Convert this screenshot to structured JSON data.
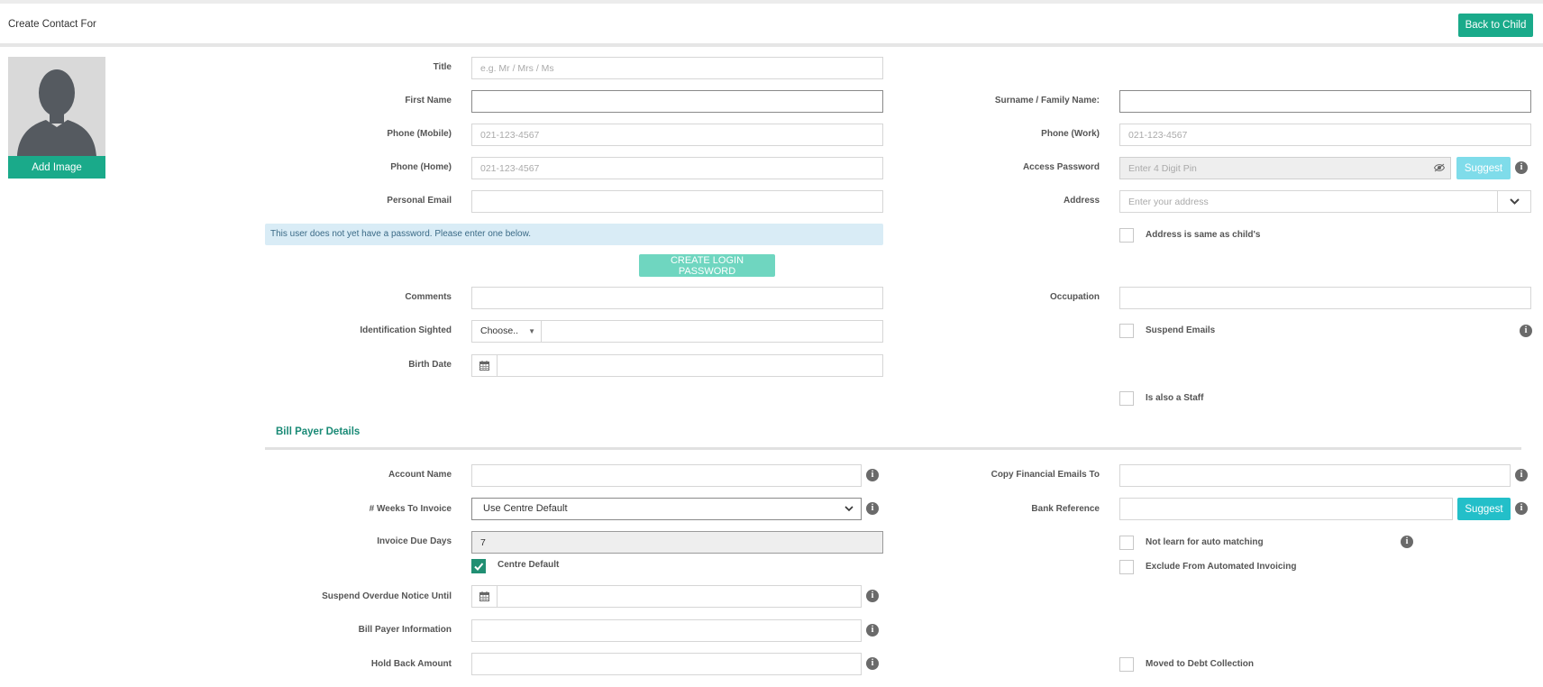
{
  "header": {
    "title": "Create Contact For",
    "back_button": "Back to Child"
  },
  "profile": {
    "add_image_button": "Add Image"
  },
  "form": {
    "title_label": "Title",
    "title_placeholder": "e.g. Mr / Mrs / Ms",
    "first_name_label": "First Name",
    "surname_label": "Surname / Family Name:",
    "phone_mobile_label": "Phone (Mobile)",
    "phone_mobile_placeholder": "021-123-4567",
    "phone_work_label": "Phone (Work)",
    "phone_work_placeholder": "021-123-4567",
    "phone_home_label": "Phone (Home)",
    "phone_home_placeholder": "021-123-4567",
    "access_password_label": "Access Password",
    "access_password_placeholder": "Enter 4 Digit Pin",
    "suggest_label": "Suggest",
    "personal_email_label": "Personal Email",
    "address_label": "Address",
    "address_placeholder": "Enter your address",
    "password_notice": "This user does not yet have a password. Please enter one below.",
    "address_same_label": "Address is same as child's",
    "create_login_password": "CREATE LOGIN PASSWORD",
    "comments_label": "Comments",
    "occupation_label": "Occupation",
    "identification_label": "Identification Sighted",
    "identification_choose": "Choose..",
    "suspend_emails_label": "Suspend Emails",
    "birth_date_label": "Birth Date",
    "is_staff_label": "Is also a Staff"
  },
  "bill_payer": {
    "section_title": "Bill Payer Details",
    "account_name_label": "Account Name",
    "copy_financial_label": "Copy Financial Emails To",
    "weeks_label": "# Weeks To Invoice",
    "weeks_value": "Use Centre Default",
    "bank_reference_label": "Bank Reference",
    "suggest_label": "Suggest",
    "invoice_due_label": "Invoice Due Days",
    "invoice_due_value": "7",
    "not_learn_label": "Not learn for auto matching",
    "exclude_label": "Exclude From Automated Invoicing",
    "centre_default_label": "Centre Default",
    "suspend_overdue_label": "Suspend Overdue Notice Until",
    "bill_payer_info_label": "Bill Payer Information",
    "hold_back_label": "Hold Back Amount",
    "debt_collection_label": "Moved to Debt Collection"
  },
  "colors": {
    "accent": "#1aaa8a",
    "accent_light": "#6fd6c0",
    "suggest_disabled": "#7fdcea",
    "suggest_active": "#23bfc9",
    "notice_bg": "#d9ecf6"
  }
}
